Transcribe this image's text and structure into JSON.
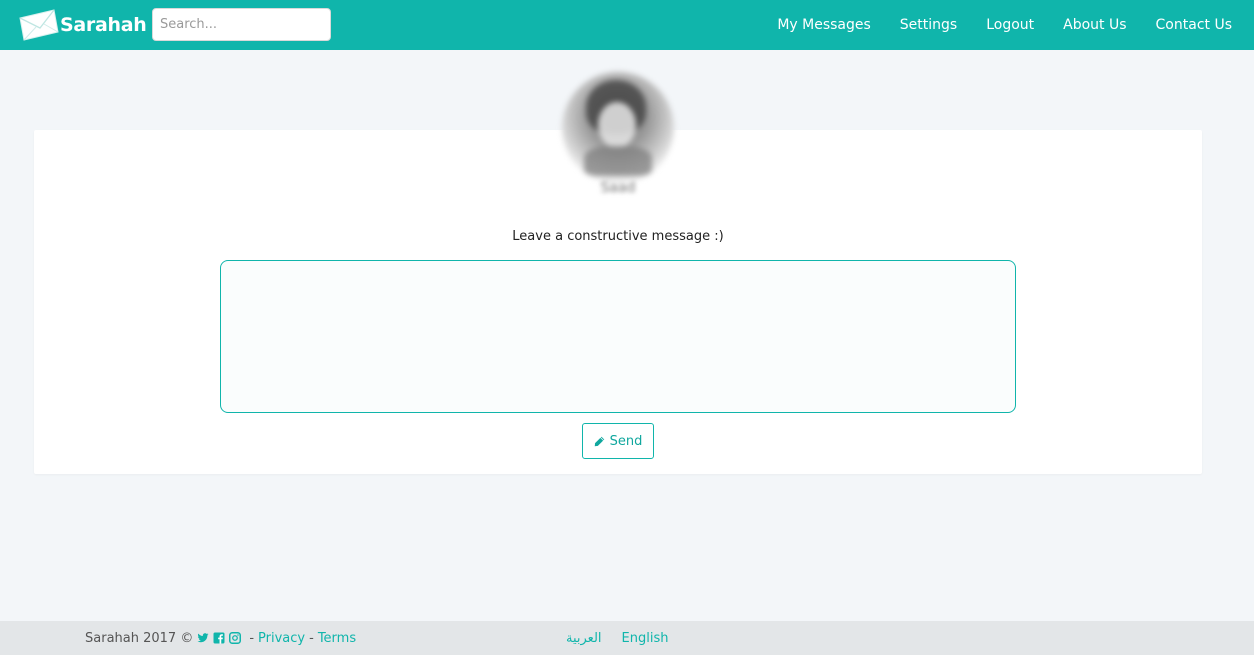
{
  "navbar": {
    "brand": "Sarahah",
    "search_placeholder": "Search...",
    "links": [
      "My Messages",
      "Settings",
      "Logout",
      "About Us",
      "Contact Us"
    ]
  },
  "profile": {
    "username": "Saad"
  },
  "message": {
    "prompt": "Leave a constructive message :)",
    "value": "",
    "send_label": "Send"
  },
  "footer": {
    "copyright": "Sarahah 2017 ©",
    "social_icons": [
      "twitter-icon",
      "facebook-icon",
      "instagram-icon"
    ],
    "privacy": "Privacy",
    "terms": "Terms",
    "languages": [
      "العربية",
      "English"
    ]
  },
  "colors": {
    "brand": "#10b5ab",
    "background": "#f3f6f9",
    "footer": "#e3e6e8"
  }
}
